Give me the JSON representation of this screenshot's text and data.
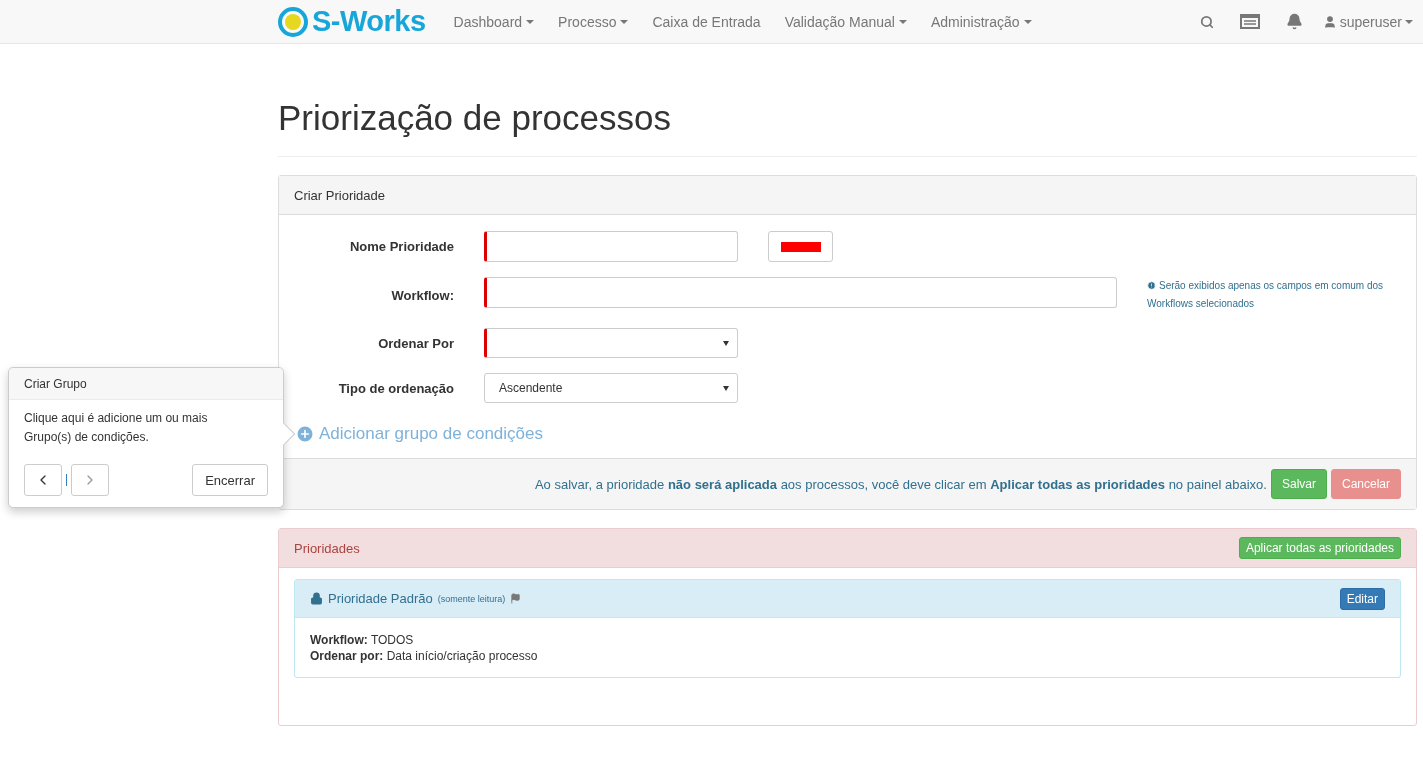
{
  "navbar": {
    "brand": "S-Works",
    "items": [
      {
        "label": "Dashboard",
        "dropdown": true
      },
      {
        "label": "Processo",
        "dropdown": true
      },
      {
        "label": "Caixa de Entrada",
        "dropdown": false
      },
      {
        "label": "Validação Manual",
        "dropdown": true
      },
      {
        "label": "Administração",
        "dropdown": true
      }
    ],
    "user": "superuser"
  },
  "page_title": "Priorização de processos",
  "create_panel": {
    "title": "Criar Prioridade",
    "fields": [
      {
        "kind": "text-color",
        "label": "Nome Prioridade",
        "required": true,
        "color": "#ff0000"
      },
      {
        "kind": "text-help",
        "label": "Workflow:",
        "required": true,
        "help": "Serão exibidos apenas os campos em comum dos Workflows selecionados"
      },
      {
        "kind": "select",
        "label": "Ordenar Por",
        "required": true
      },
      {
        "kind": "select",
        "label": "Tipo de ordenação",
        "required": false,
        "value": "Ascendente"
      }
    ],
    "add_group": "Adicionar grupo de condições",
    "footer_note": "Ao salvar, a prioridade **não será aplicada** aos processos, você deve clicar em **Aplicar todas as prioridades** no painel abaixo.",
    "save": "Salvar",
    "cancel": "Cancelar"
  },
  "priorities_panel": {
    "title": "Prioridades",
    "apply_all": "Aplicar todas as prioridades",
    "items": [
      {
        "title": "Prioridade Padrão",
        "note": "(somente leitura)",
        "edit": "Editar",
        "lines": [
          "**Workflow:** TODOS",
          "**Ordenar por:** Data início/criação processo"
        ]
      }
    ]
  },
  "popover": {
    "title": "Criar Grupo",
    "body": "Clique aqui é adicione um ou mais Grupo(s) de condições.",
    "end": "Encerrar"
  }
}
